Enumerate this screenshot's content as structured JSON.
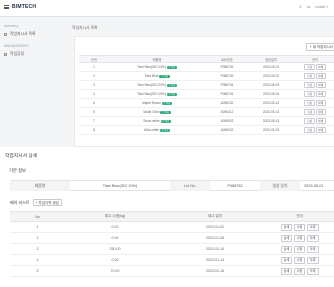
{
  "header": {
    "logo": "BIMTECH",
    "right": [
      "①",
      "ko",
      "model 1"
    ]
  },
  "sidebar": {
    "sections": [
      {
        "title": "Inventory",
        "item": "작업지시서 목록"
      },
      {
        "title": "MANAGEMENT",
        "item": "작업공정"
      }
    ]
  },
  "page": {
    "breadcrumb": "작업지시서 목록",
    "add_button": "+ 새 작업지시서",
    "columns": [
      "순번",
      "제품명",
      "로트번호",
      "생성일자",
      "관리"
    ],
    "rows": [
      {
        "no": "1",
        "name": "Tiani Blue(ISO 10%)",
        "badge": "진행중",
        "lot": "P086752",
        "date": "2023-05-01"
      },
      {
        "no": "2",
        "name": "Tiani Blue",
        "badge": "진행중",
        "lot": "P086782",
        "date": "2023-05-02"
      },
      {
        "no": "3",
        "name": "Tiani Blue(ISO 20%)",
        "badge": "진행중",
        "lot": "P086761",
        "date": "2023-05-03"
      },
      {
        "no": "4",
        "name": "Tiani Blue(ISO 15%)",
        "badge": "진행중",
        "lot": "P086751",
        "date": "2023-05-04"
      },
      {
        "no": "5",
        "name": "Maple Brown",
        "badge": "진행중",
        "lot": "A096232",
        "date": "2023-05-12"
      },
      {
        "no": "6",
        "name": "Moab Olive",
        "badge": "진행중",
        "lot": "A096212",
        "date": "2023-05-13"
      },
      {
        "no": "7",
        "name": "Snow white",
        "badge": "진행중",
        "lot": "A096002",
        "date": "2023-05-13"
      },
      {
        "no": "8",
        "name": "Ultra white",
        "badge": "진행중",
        "lot": "A096032",
        "date": "2023-05-15"
      }
    ],
    "row_actions": [
      "수정",
      "삭제"
    ]
  },
  "detail": {
    "title": "작업지시서 상세",
    "basic_title": "기본 정보",
    "product_label": "제품명",
    "product_value": "Tiani Blue(ISO 10%)",
    "lot_label": "Lot No.",
    "lot_value": "P086752",
    "date_label": "생성 일자",
    "date_value": "2023-05-01",
    "history_label": "배치 리스트",
    "history_add": "+ 투입이력 생성",
    "columns": [
      "No",
      "재고 수량(kg)",
      "재고 일자",
      "관리"
    ],
    "rows": [
      {
        "no": "1",
        "qty": "0.00",
        "date": "2023-01-02"
      },
      {
        "no": "2",
        "qty": "0.00",
        "date": "2023-01-08"
      },
      {
        "no": "3",
        "qty": "250.00",
        "date": "2023-01-10"
      },
      {
        "no": "4",
        "qty": "0.00",
        "date": "2023-01-14"
      },
      {
        "no": "5",
        "qty": "70.00",
        "date": "2023-01-15"
      }
    ],
    "row_actions": [
      "상세",
      "수정",
      "삭제"
    ]
  },
  "colors": {
    "accent": "#2c53d6",
    "badge": "#1fa56d",
    "sidebar_bg": "#f4f5f7"
  }
}
